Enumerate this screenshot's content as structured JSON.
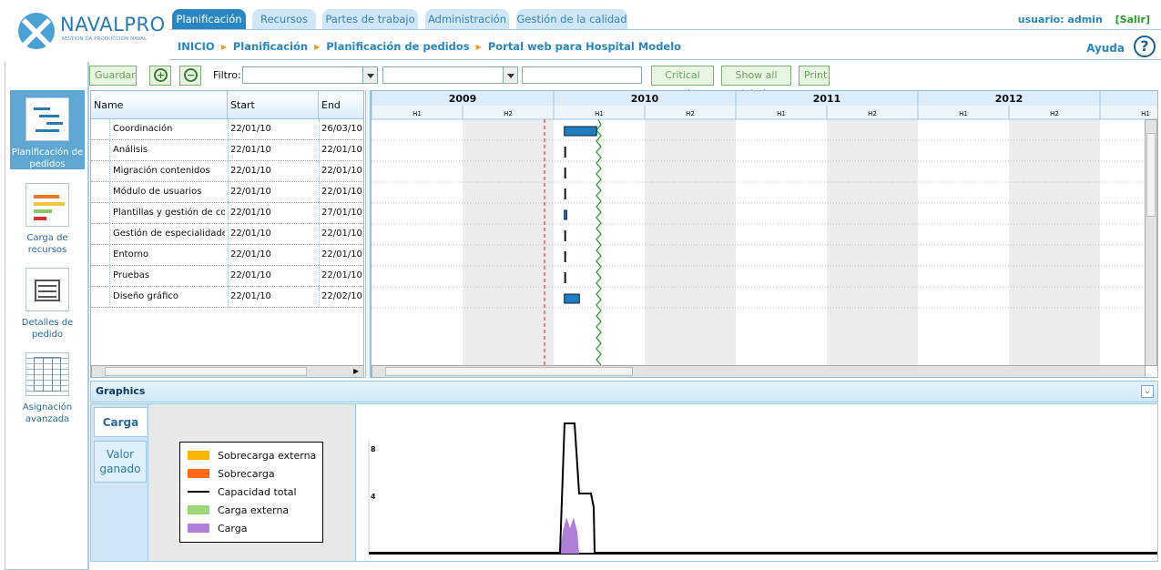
{
  "brand": {
    "name": "NAVALPRO",
    "tagline": "XESTION DA PRODUCCION NAVAL"
  },
  "nav": {
    "tabs": [
      {
        "label": "Planificación",
        "active": true
      },
      {
        "label": "Recursos",
        "active": false
      },
      {
        "label": "Partes de trabajo",
        "active": false
      },
      {
        "label": "Administración",
        "active": false
      },
      {
        "label": "Gestión de la calidad",
        "active": false
      }
    ]
  },
  "user": {
    "label": "usuario: admin",
    "logout": "[Salir]"
  },
  "breadcrumb": [
    "INICIO",
    "Planificación",
    "Planificación de pedidos",
    "Portal web para Hospital Modelo"
  ],
  "help": {
    "label": "Ayuda",
    "icon": "help-icon"
  },
  "perspectives": [
    {
      "label": "Planificación de pedidos",
      "icon": "gantt-icon",
      "active": true
    },
    {
      "label": "Carga de recursos",
      "icon": "resource-load-icon",
      "active": false
    },
    {
      "label": "Detalles de pedido",
      "icon": "order-details-icon",
      "active": false
    },
    {
      "label": "Asignación avanzada",
      "icon": "advanced-allocation-icon",
      "active": false
    }
  ],
  "toolbar": {
    "save": "Guardar",
    "zoom_in_icon": "zoom-in-icon",
    "zoom_out_icon": "zoom-out-icon",
    "filter_label": "Filtro:",
    "filter_value": "",
    "filter2_value": "",
    "search_value": "",
    "critical_path": "Critical path",
    "show_labels": "Show all labels",
    "print": "Print"
  },
  "grid": {
    "columns": [
      "Name",
      "Start",
      "End"
    ],
    "rows": [
      {
        "name": "Coordinación",
        "start": "22/01/10",
        "end": "26/03/10"
      },
      {
        "name": "Análisis",
        "start": "22/01/10",
        "end": "22/01/10"
      },
      {
        "name": "Migración contenidos",
        "start": "22/01/10",
        "end": "22/01/10"
      },
      {
        "name": "Módulo de usuarios",
        "start": "22/01/10",
        "end": "22/01/10"
      },
      {
        "name": "Plantillas y gestión de con",
        "start": "22/01/10",
        "end": "27/01/10"
      },
      {
        "name": "Gestión de especialidades",
        "start": "22/01/10",
        "end": "22/01/10"
      },
      {
        "name": "Entorno",
        "start": "22/01/10",
        "end": "22/01/10"
      },
      {
        "name": "Pruebas",
        "start": "22/01/10",
        "end": "22/01/10"
      },
      {
        "name": "Diseño gráfico",
        "start": "22/01/10",
        "end": "22/02/10"
      }
    ]
  },
  "timeline": {
    "years": [
      "2009",
      "2010",
      "2011",
      "2012",
      ""
    ],
    "halves": [
      "H1",
      "H2",
      "H1",
      "H2",
      "H1",
      "H2",
      "H1",
      "H2",
      "H1"
    ]
  },
  "graphics": {
    "title": "Graphics",
    "tabs": [
      {
        "label": "Carga",
        "active": true
      },
      {
        "label": "Valor ganado",
        "active": false
      }
    ],
    "legend": [
      {
        "label": "Sobrecarga externa",
        "color": "#f7b500",
        "kind": "box"
      },
      {
        "label": "Sobrecarga",
        "color": "#ff6a1a",
        "kind": "box"
      },
      {
        "label": "Capacidad total",
        "color": "#000000",
        "kind": "line"
      },
      {
        "label": "Carga externa",
        "color": "#9ad87a",
        "kind": "box"
      },
      {
        "label": "Carga",
        "color": "#b07fd8",
        "kind": "box"
      }
    ],
    "y_ticks": [
      "8",
      "4"
    ]
  },
  "colors": {
    "accent": "#2a86c0",
    "task_bar": "#1f7bc0",
    "today_line": "#2aa02a",
    "project_start_line": "#d02020"
  }
}
